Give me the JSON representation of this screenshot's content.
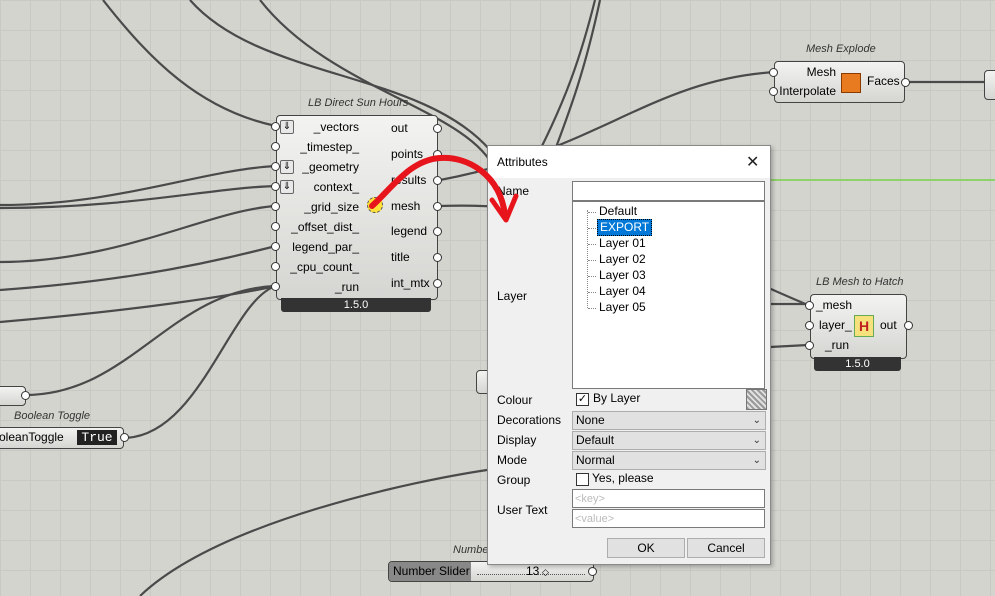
{
  "direct_sun_hours": {
    "title": "LB Direct Sun Hours",
    "inputs": [
      "_vectors",
      "_timestep_",
      "_geometry",
      "context_",
      "_grid_size",
      "_offset_dist_",
      "legend_par_",
      "_cpu_count_",
      "_run"
    ],
    "outputs": [
      "out",
      "points",
      "results",
      "mesh",
      "legend",
      "title",
      "int_mtx"
    ],
    "version": "1.5.0"
  },
  "mesh_explode": {
    "title": "Mesh Explode",
    "inputs": [
      "Mesh",
      "Interpolate"
    ],
    "outputs": [
      "Faces"
    ]
  },
  "mesh_to_hatch": {
    "title": "LB Mesh to Hatch",
    "inputs": [
      "_mesh",
      "layer_",
      "_run"
    ],
    "outputs": [
      "out"
    ],
    "version": "1.5.0"
  },
  "boolean_toggle": {
    "title": "Boolean Toggle",
    "label": "oleanToggle",
    "value": "True"
  },
  "number_slider": {
    "title": "Numbe",
    "label": "Number Slider",
    "value": "13"
  },
  "dialog": {
    "title": "Attributes",
    "close_glyph": "✕",
    "name_label": "Name",
    "name_value": "",
    "layer_label": "Layer",
    "layers": [
      "Default",
      "EXPORT",
      "Layer 01",
      "Layer 02",
      "Layer 03",
      "Layer 04",
      "Layer 05"
    ],
    "selected_layer": "EXPORT",
    "colour_label": "Colour",
    "colour_checkbox": "By Layer",
    "decorations_label": "Decorations",
    "decorations_value": "None",
    "display_label": "Display",
    "display_value": "Default",
    "mode_label": "Mode",
    "mode_value": "Normal",
    "group_label": "Group",
    "group_checkbox": "Yes, please",
    "user_text_label": "User Text",
    "key_placeholder": "<key>",
    "value_placeholder": "<value>",
    "ok_label": "OK",
    "cancel_label": "Cancel"
  },
  "colors": {
    "canvas": "#d4d4cf",
    "wire": "#4a4a4a",
    "annotation": "#e8141c",
    "selection": "#0078d7",
    "green_wire": "#8fd16a"
  }
}
